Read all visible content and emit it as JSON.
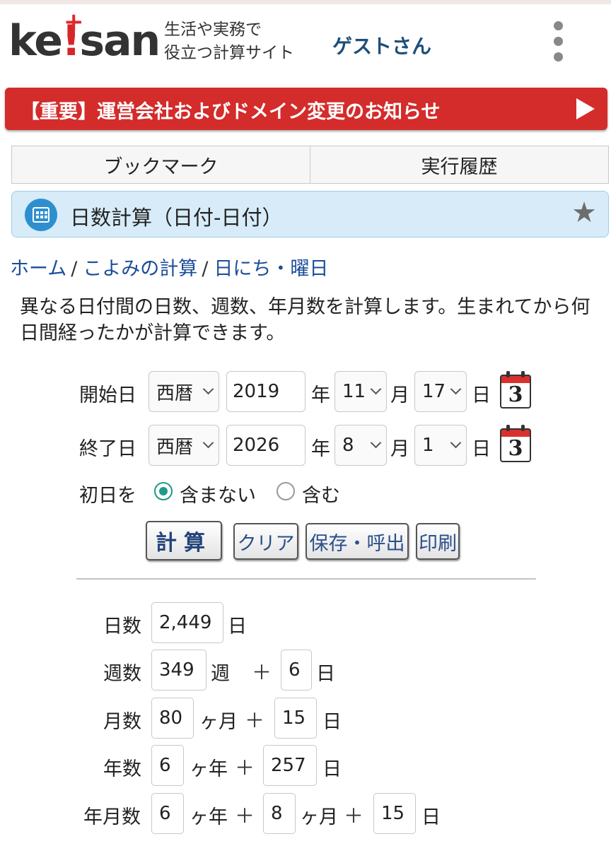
{
  "header": {
    "logo_pre": "ke",
    "logo_bang": "!",
    "logo_post": "san",
    "logo_plus": "+",
    "tagline_1": "生活や実務で",
    "tagline_2": "役立つ計算サイト",
    "user": "ゲストさん"
  },
  "notice": {
    "text": "【重要】運営会社およびドメイン変更のお知らせ"
  },
  "tabs": [
    {
      "label": "ブックマーク"
    },
    {
      "label": "実行履歴"
    }
  ],
  "title": {
    "text": "日数計算（日付-日付）"
  },
  "breadcrumb": [
    {
      "label": "ホーム"
    },
    {
      "label": "こよみの計算"
    },
    {
      "label": "日にち・曜日"
    }
  ],
  "breadcrumb_sep": "/",
  "description": "異なる日付間の日数、週数、年月数を計算します。生まれてから何日間経ったかが計算できます。",
  "form": {
    "start": {
      "label": "開始日",
      "era": "西暦",
      "year": "2019",
      "year_unit": "年",
      "month": "11",
      "month_unit": "月",
      "day": "17",
      "day_unit": "日"
    },
    "end": {
      "label": "終了日",
      "era": "西暦",
      "year": "2026",
      "year_unit": "年",
      "month": "8",
      "month_unit": "月",
      "day": "1",
      "day_unit": "日"
    },
    "calendar_glyph": "3",
    "first_day_label": "初日を",
    "option_exclude": "含まない",
    "option_include": "含む",
    "selected": "exclude"
  },
  "buttons": {
    "calc": "計算",
    "clear": "クリア",
    "save": "保存・呼出",
    "print": "印刷"
  },
  "results": {
    "plus": "＋",
    "days": {
      "label": "日数",
      "value": "2,449",
      "unit": "日"
    },
    "weeks": {
      "label": "週数",
      "value": "349",
      "unit": "週",
      "rem": "6",
      "rem_unit": "日"
    },
    "months": {
      "label": "月数",
      "value": "80",
      "unit": "ヶ月",
      "rem": "15",
      "rem_unit": "日"
    },
    "years": {
      "label": "年数",
      "value": "6",
      "unit": "ヶ年",
      "rem": "257",
      "rem_unit": "日"
    },
    "ym": {
      "label": "年月数",
      "value": "6",
      "unit": "ヶ年",
      "months": "8",
      "months_unit": "ヶ月",
      "rem": "15",
      "rem_unit": "日"
    }
  },
  "colors": {
    "accent_red": "#d42b2b",
    "brand_blue": "#1d4e7a",
    "link": "#1a4d99",
    "radio": "#1f9a8a",
    "title_bg": "#d7ecf8"
  }
}
